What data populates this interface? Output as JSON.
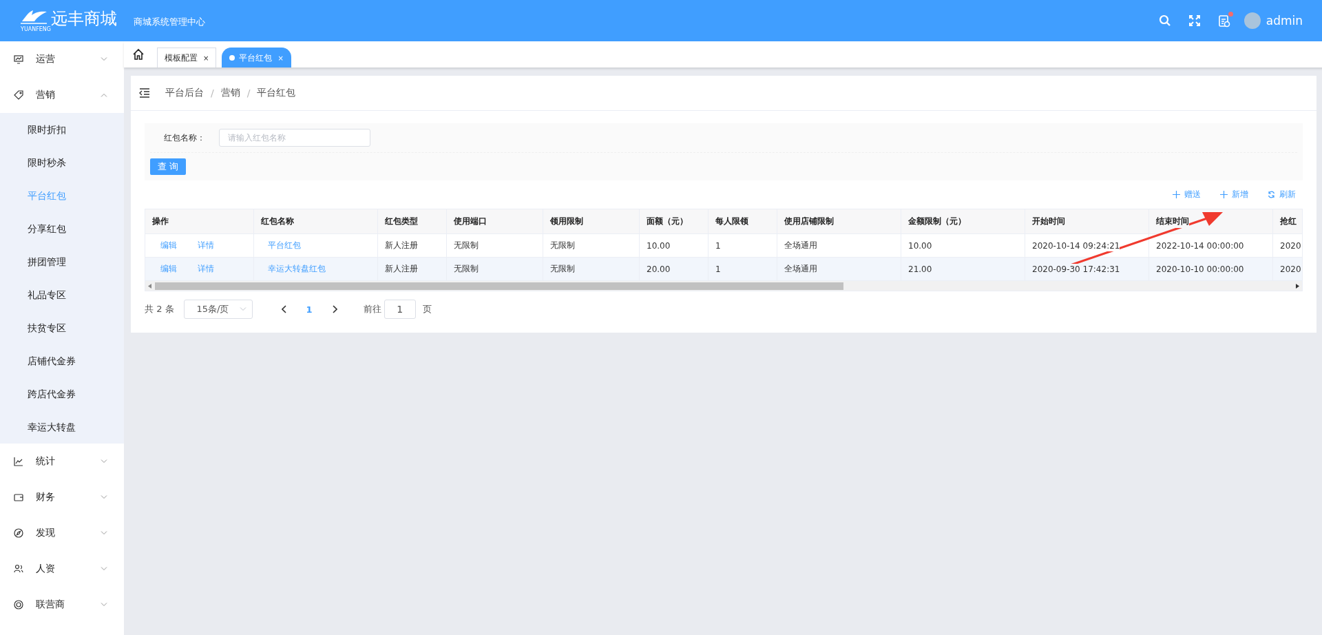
{
  "header": {
    "logo_text": "远丰商城",
    "logo_sub": "YUANFENG",
    "subtitle": "商城系统管理中心",
    "user": "admin",
    "notice": true
  },
  "sidebar": {
    "items": [
      {
        "label": "运营",
        "kind": "monitor",
        "expanded": false
      },
      {
        "label": "营销",
        "kind": "tag",
        "expanded": true,
        "children": [
          {
            "label": "限时折扣",
            "selected": false
          },
          {
            "label": "限时秒杀",
            "selected": false
          },
          {
            "label": "平台红包",
            "selected": true
          },
          {
            "label": "分享红包",
            "selected": false
          },
          {
            "label": "拼团管理",
            "selected": false
          },
          {
            "label": "礼品专区",
            "selected": false
          },
          {
            "label": "扶贫专区",
            "selected": false
          },
          {
            "label": "店铺代金券",
            "selected": false
          },
          {
            "label": "跨店代金券",
            "selected": false
          },
          {
            "label": "幸运大转盘",
            "selected": false
          }
        ]
      },
      {
        "label": "统计",
        "kind": "chart",
        "expanded": false
      },
      {
        "label": "财务",
        "kind": "wallet",
        "expanded": false
      },
      {
        "label": "发现",
        "kind": "compass",
        "expanded": false
      },
      {
        "label": "人资",
        "kind": "people",
        "expanded": false
      },
      {
        "label": "联营商",
        "kind": "target",
        "expanded": false
      }
    ]
  },
  "tabs": [
    {
      "label": "模板配置",
      "close": "×",
      "selected": false
    },
    {
      "label": "平台红包",
      "close": "×",
      "selected": true
    }
  ],
  "breadcrumb": {
    "items": [
      "平台后台",
      "营销",
      "平台红包"
    ],
    "separator": "/"
  },
  "search": {
    "label": "红包名称：",
    "placeholder": "请输入红包名称",
    "button": "查 询"
  },
  "actions": [
    {
      "label": "赠送",
      "kind": "plus"
    },
    {
      "label": "新增",
      "kind": "plus"
    },
    {
      "label": "刷新",
      "kind": "refresh"
    }
  ],
  "table": {
    "columns": [
      "操作",
      "红包名称",
      "红包类型",
      "使用端口",
      "领用限制",
      "面额（元）",
      "每人限领",
      "使用店铺限制",
      "金额限制（元）",
      "开始时间",
      "结束时间",
      "抢红"
    ],
    "rows": [
      {
        "selected": false,
        "cells": [
          [
            "编辑",
            "详情"
          ],
          "平台红包",
          "新人注册",
          "无限制",
          "无限制",
          "10.00",
          "1",
          "全场通用",
          "10.00",
          "2020-10-14 09:24:21",
          "2022-10-14 00:00:00",
          "2020"
        ]
      },
      {
        "selected": true,
        "cells": [
          [
            "编辑",
            "详情"
          ],
          "幸运大转盘红包",
          "新人注册",
          "无限制",
          "无限制",
          "20.00",
          "1",
          "全场通用",
          "21.00",
          "2020-09-30 17:42:31",
          "2020-10-10 00:00:00",
          "2020"
        ]
      }
    ]
  },
  "pagination": {
    "total": "共 2 条",
    "page_size": "15条/页",
    "pages": [
      {
        "label": "1",
        "selected": true
      }
    ],
    "goto_label": "前往",
    "goto_value": "1",
    "goto_suffix": "页"
  }
}
